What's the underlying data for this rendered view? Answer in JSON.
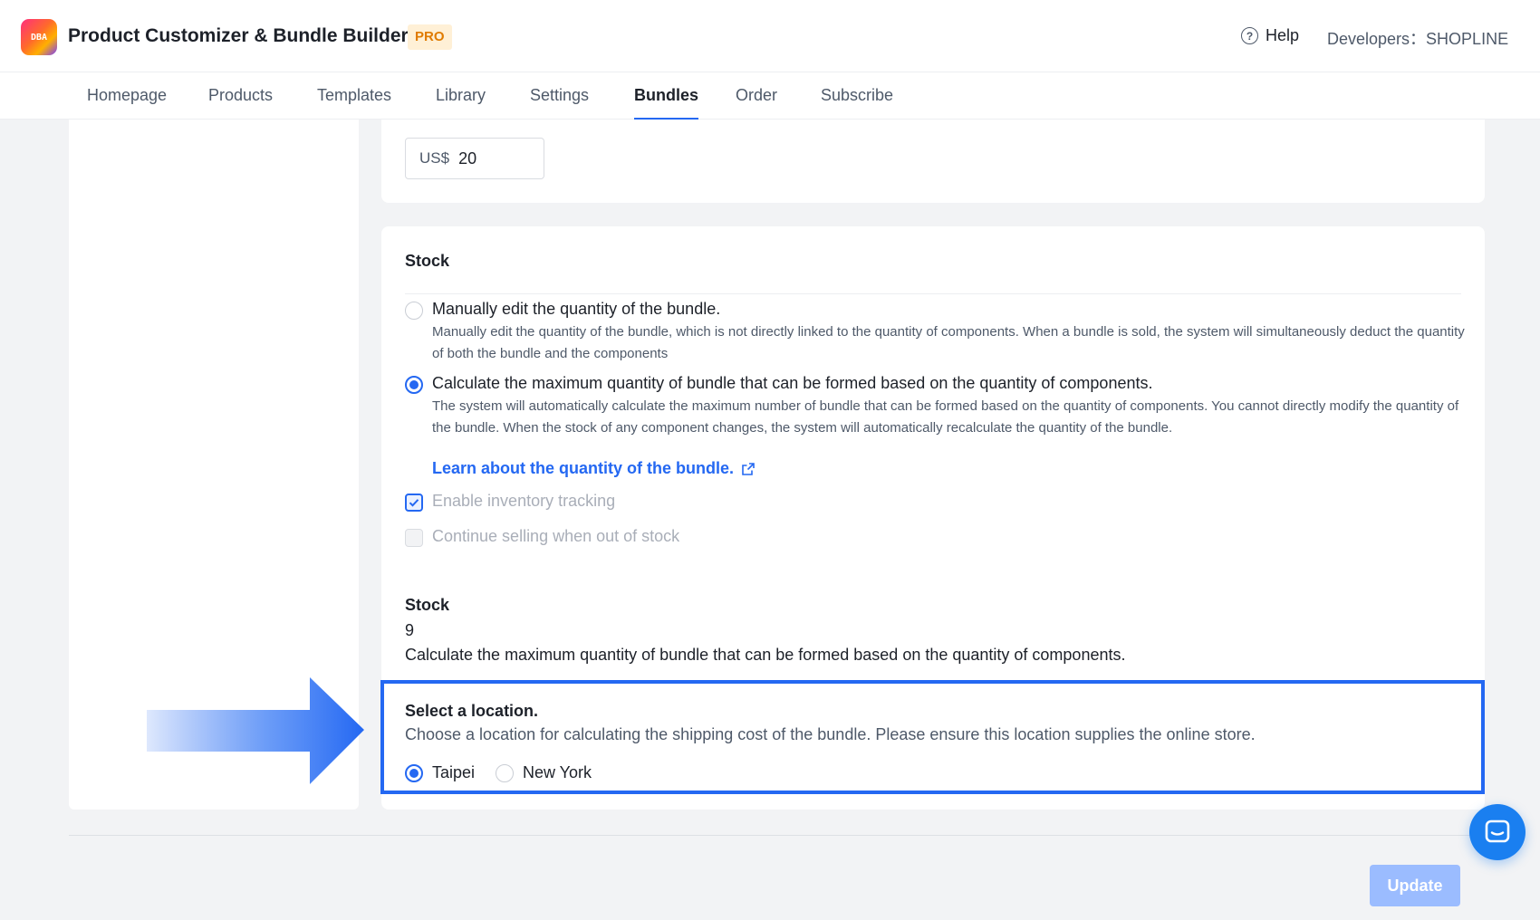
{
  "header": {
    "logo_text": "DBA",
    "app_title": "Product Customizer & Bundle Builder",
    "badge": "PRO",
    "help_label": "Help",
    "developers_label": "Developers：SHOPLINE"
  },
  "nav": {
    "tabs": [
      {
        "label": "Homepage",
        "active": false
      },
      {
        "label": "Products",
        "active": false
      },
      {
        "label": "Templates",
        "active": false
      },
      {
        "label": "Library",
        "active": false
      },
      {
        "label": "Settings",
        "active": false
      },
      {
        "label": "Bundles",
        "active": true
      },
      {
        "label": "Order",
        "active": false
      },
      {
        "label": "Subscribe",
        "active": false
      }
    ]
  },
  "price": {
    "currency": "US$",
    "value": "20"
  },
  "stock_section": {
    "title": "Stock",
    "options": [
      {
        "label": "Manually edit the quantity of the bundle.",
        "description": "Manually edit the quantity of the bundle, which is not directly linked to the quantity of components. When a bundle is sold, the system will simultaneously deduct the quantity of both the bundle and the components",
        "selected": false
      },
      {
        "label": "Calculate the maximum quantity of bundle that can be formed based on the quantity of components.",
        "description": "The system will automatically calculate the maximum number of bundle that can be formed based on the quantity of components. You cannot directly modify the quantity of the bundle. When the stock of any component changes, the system will automatically recalculate the quantity of the bundle.",
        "selected": true
      }
    ],
    "learn_link": "Learn about the quantity of the bundle.",
    "checkboxes": [
      {
        "label": "Enable inventory tracking",
        "checked": true
      },
      {
        "label": "Continue selling when out of stock",
        "checked": false
      }
    ],
    "stock_heading": "Stock",
    "stock_value": "9",
    "stock_note": "Calculate the maximum quantity of bundle that can be formed based on the quantity of components."
  },
  "location": {
    "title": "Select a location.",
    "description": "Choose a location for calculating the shipping cost of the bundle. Please ensure this location supplies the online store.",
    "options": [
      {
        "label": "Taipei",
        "selected": true
      },
      {
        "label": "New York",
        "selected": false
      }
    ]
  },
  "footer": {
    "update_label": "Update"
  },
  "colors": {
    "accent": "#2468f2",
    "highlight_border": "#2468f2",
    "disabled_button": "#9bbcff",
    "badge_bg": "#fff0d6",
    "badge_text": "#e07b00"
  },
  "icons": {
    "help": "help-circle-icon",
    "external_link": "external-link-icon",
    "chat": "chat-bubble-icon",
    "arrow": "arrow-right-icon"
  }
}
